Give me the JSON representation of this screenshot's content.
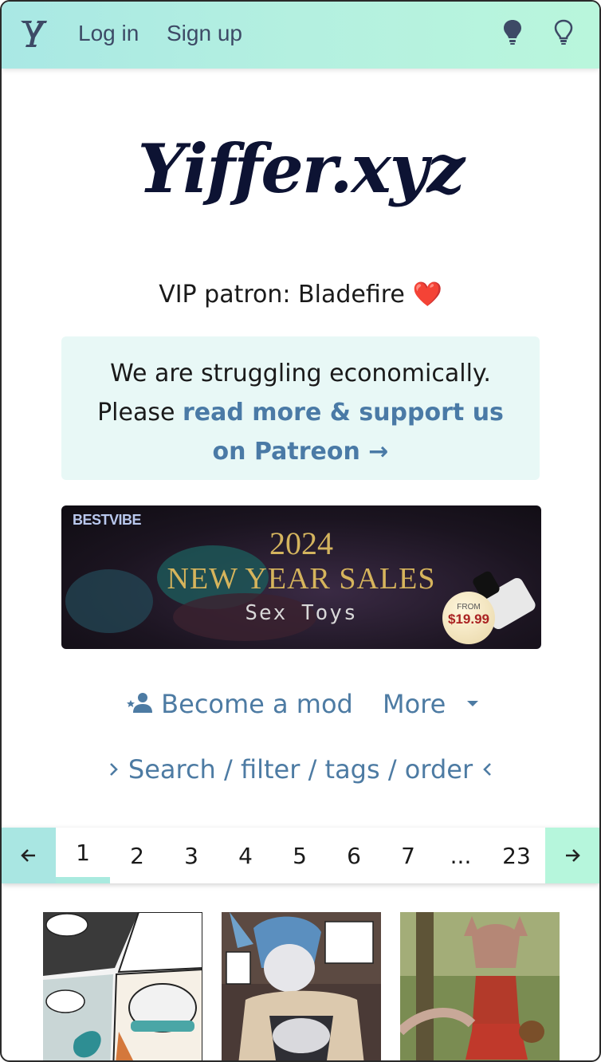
{
  "nav": {
    "login": "Log in",
    "signup": "Sign up"
  },
  "hero": {
    "title": "Yiffer.xyz"
  },
  "vip": {
    "text": "VIP patron: Bladefire",
    "heart": "❤️"
  },
  "notice": {
    "line1": "We are struggling economically.",
    "line2_prefix": "Please ",
    "link": "read more & support us on Patreon",
    "arrow": "→"
  },
  "ad": {
    "brand": "BESTVIBE",
    "year": "2024",
    "headline": "NEW YEAR SALES",
    "subline": "Sex Toys",
    "price_from": "FROM",
    "price": "$19.99"
  },
  "actions": {
    "become_mod": "Become a mod",
    "more": "More",
    "search": "Search / filter / tags / order"
  },
  "pagination": {
    "pages": [
      "1",
      "2",
      "3",
      "4",
      "5",
      "6",
      "7",
      "...",
      "23"
    ],
    "active": "1"
  },
  "icons": {
    "logo": "yiffer-y-logo",
    "theme_dark": "lightbulb-filled-icon",
    "theme_light": "lightbulb-outline-icon",
    "mod": "user-star-icon",
    "caret": "caret-down-icon",
    "prev": "arrow-left-icon",
    "next": "arrow-right-icon"
  },
  "colors": {
    "accent_link": "#4d7ba3",
    "title": "#0d1333",
    "nav_gradient_start": "#a9e8e4",
    "nav_gradient_end": "#b9f6dc",
    "notice_bg": "#e8f8f6"
  }
}
